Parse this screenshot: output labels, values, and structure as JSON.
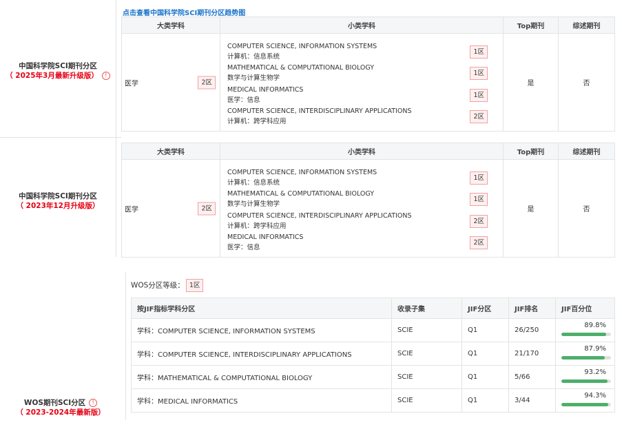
{
  "cas_trend_link": "点击查看中国科学院SCI期刊分区趋势图",
  "cas_headers": {
    "major": "大类学科",
    "minor": "小类学科",
    "top": "Top期刊",
    "review": "综述期刊"
  },
  "cas2025": {
    "label_line1": "中国科学院SCI期刊分区",
    "label_line2": "（ 2025年3月最新升级版）",
    "info_glyph": "!",
    "major_subject": "医学",
    "major_zone": "2区",
    "top": "是",
    "review": "否",
    "subjects": [
      {
        "en": "COMPUTER SCIENCE, INFORMATION SYSTEMS",
        "cn": "计算机：信息系统",
        "zone": "1区"
      },
      {
        "en": "MATHEMATICAL & COMPUTATIONAL BIOLOGY",
        "cn": "数学与计算生物学",
        "zone": "1区"
      },
      {
        "en": "MEDICAL INFORMATICS",
        "cn": "医学：信息",
        "zone": "1区"
      },
      {
        "en": "COMPUTER SCIENCE, INTERDISCIPLINARY APPLICATIONS",
        "cn": "计算机：跨学科应用",
        "zone": "2区"
      }
    ]
  },
  "cas2023": {
    "label_line1": "中国科学院SCI期刊分区",
    "label_line2": "（ 2023年12月升级版）",
    "major_subject": "医学",
    "major_zone": "2区",
    "top": "是",
    "review": "否",
    "subjects": [
      {
        "en": "COMPUTER SCIENCE, INFORMATION SYSTEMS",
        "cn": "计算机：信息系统",
        "zone": "1区"
      },
      {
        "en": "MATHEMATICAL & COMPUTATIONAL BIOLOGY",
        "cn": "数学与计算生物学",
        "zone": "1区"
      },
      {
        "en": "COMPUTER SCIENCE, INTERDISCIPLINARY APPLICATIONS",
        "cn": "计算机：跨学科应用",
        "zone": "2区"
      },
      {
        "en": "MEDICAL INFORMATICS",
        "cn": "医学：信息",
        "zone": "2区"
      }
    ]
  },
  "wos": {
    "label_line1": "WOS期刊SCI分区",
    "label_line2": "（ 2023-2024年最新版）",
    "info_glyph": "!",
    "level_label": "WOS分区等级：",
    "level_value": "1区",
    "headers": {
      "subject": "按JIF指标学科分区",
      "collection": "收录子集",
      "quartile": "JIF分区",
      "rank": "JIF排名",
      "percentile": "JIF百分位"
    },
    "rows": [
      {
        "subject": "学科：COMPUTER SCIENCE, INFORMATION SYSTEMS",
        "collection": "SCIE",
        "quartile": "Q1",
        "rank": "26/250",
        "percentile": "89.8%",
        "pct": 89.8
      },
      {
        "subject": "学科：COMPUTER SCIENCE, INTERDISCIPLINARY APPLICATIONS",
        "collection": "SCIE",
        "quartile": "Q1",
        "rank": "21/170",
        "percentile": "87.9%",
        "pct": 87.9
      },
      {
        "subject": "学科：MATHEMATICAL & COMPUTATIONAL BIOLOGY",
        "collection": "SCIE",
        "quartile": "Q1",
        "rank": "5/66",
        "percentile": "93.2%",
        "pct": 93.2
      },
      {
        "subject": "学科：MEDICAL INFORMATICS",
        "collection": "SCIE",
        "quartile": "Q1",
        "rank": "3/44",
        "percentile": "94.3%",
        "pct": 94.3
      }
    ]
  },
  "colors": {
    "link": "#1a73c9",
    "accent_red": "#e60012",
    "badge_border": "#f2a0a0",
    "bar_fill": "#4caf6a"
  }
}
